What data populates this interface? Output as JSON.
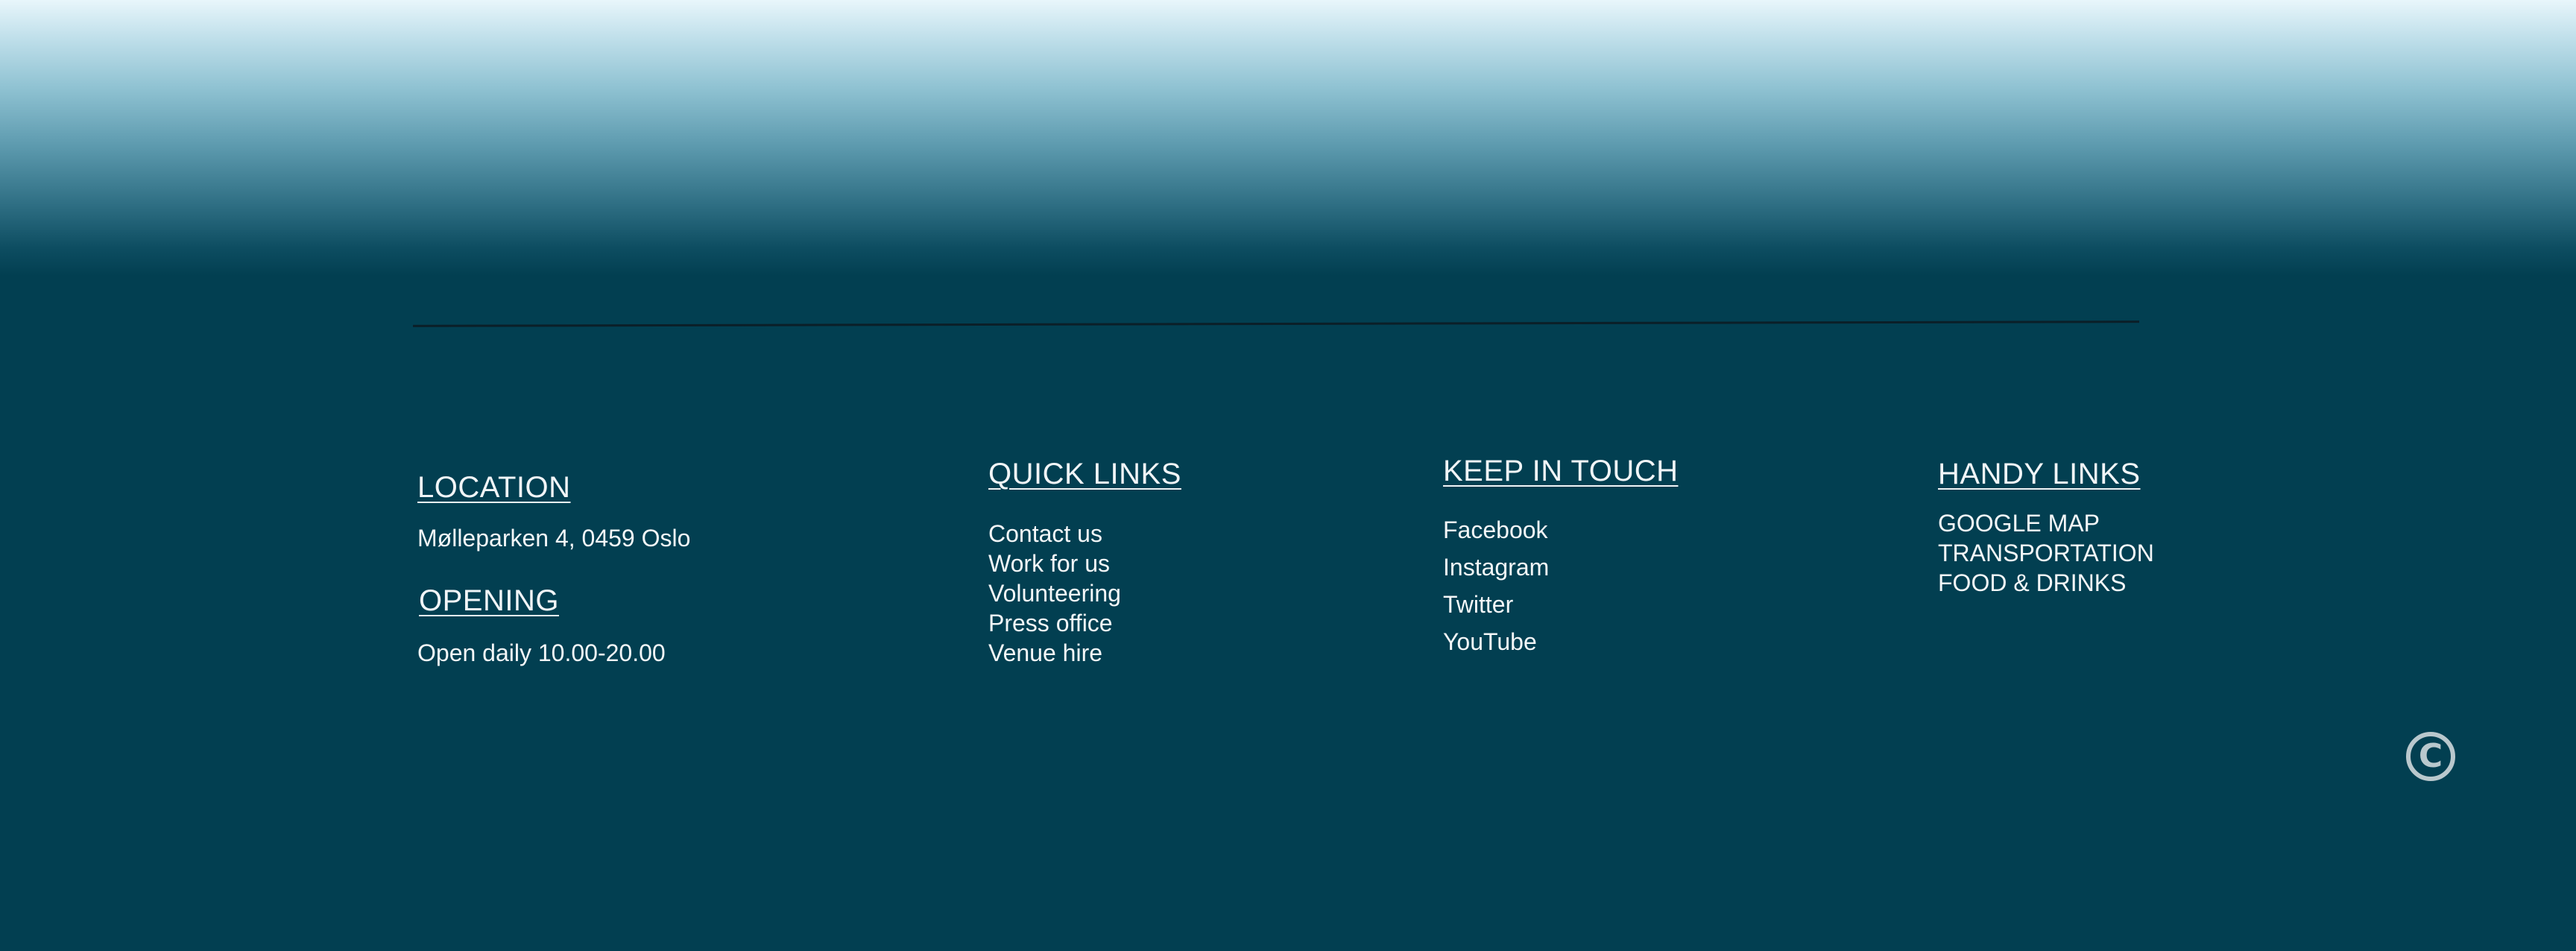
{
  "footer": {
    "location": {
      "heading": "LOCATION",
      "address": "Mølleparken 4, 0459 Oslo"
    },
    "opening": {
      "heading": "OPENING",
      "hours": "Open daily 10.00-20.00"
    },
    "quick_links": {
      "heading": "QUICK LINKS",
      "items": [
        "Contact us",
        "Work for us",
        "Volunteering",
        "Press office",
        "Venue hire"
      ]
    },
    "keep_in_touch": {
      "heading": "KEEP IN TOUCH",
      "items": [
        "Facebook",
        "Instagram",
        "Twitter",
        "YouTube"
      ]
    },
    "handy_links": {
      "heading": "HANDY LINKS",
      "items": [
        "GOOGLE MAP",
        "TRANSPORTATION",
        "FOOD & DRINKS"
      ]
    },
    "copyright_symbol": "C",
    "copyright_icon": "copyright-icon"
  },
  "colors": {
    "background": "#023f51",
    "gradient_top": "#e8f6fb",
    "text": "#f4f7f8",
    "icon": "#b9c8cd"
  }
}
